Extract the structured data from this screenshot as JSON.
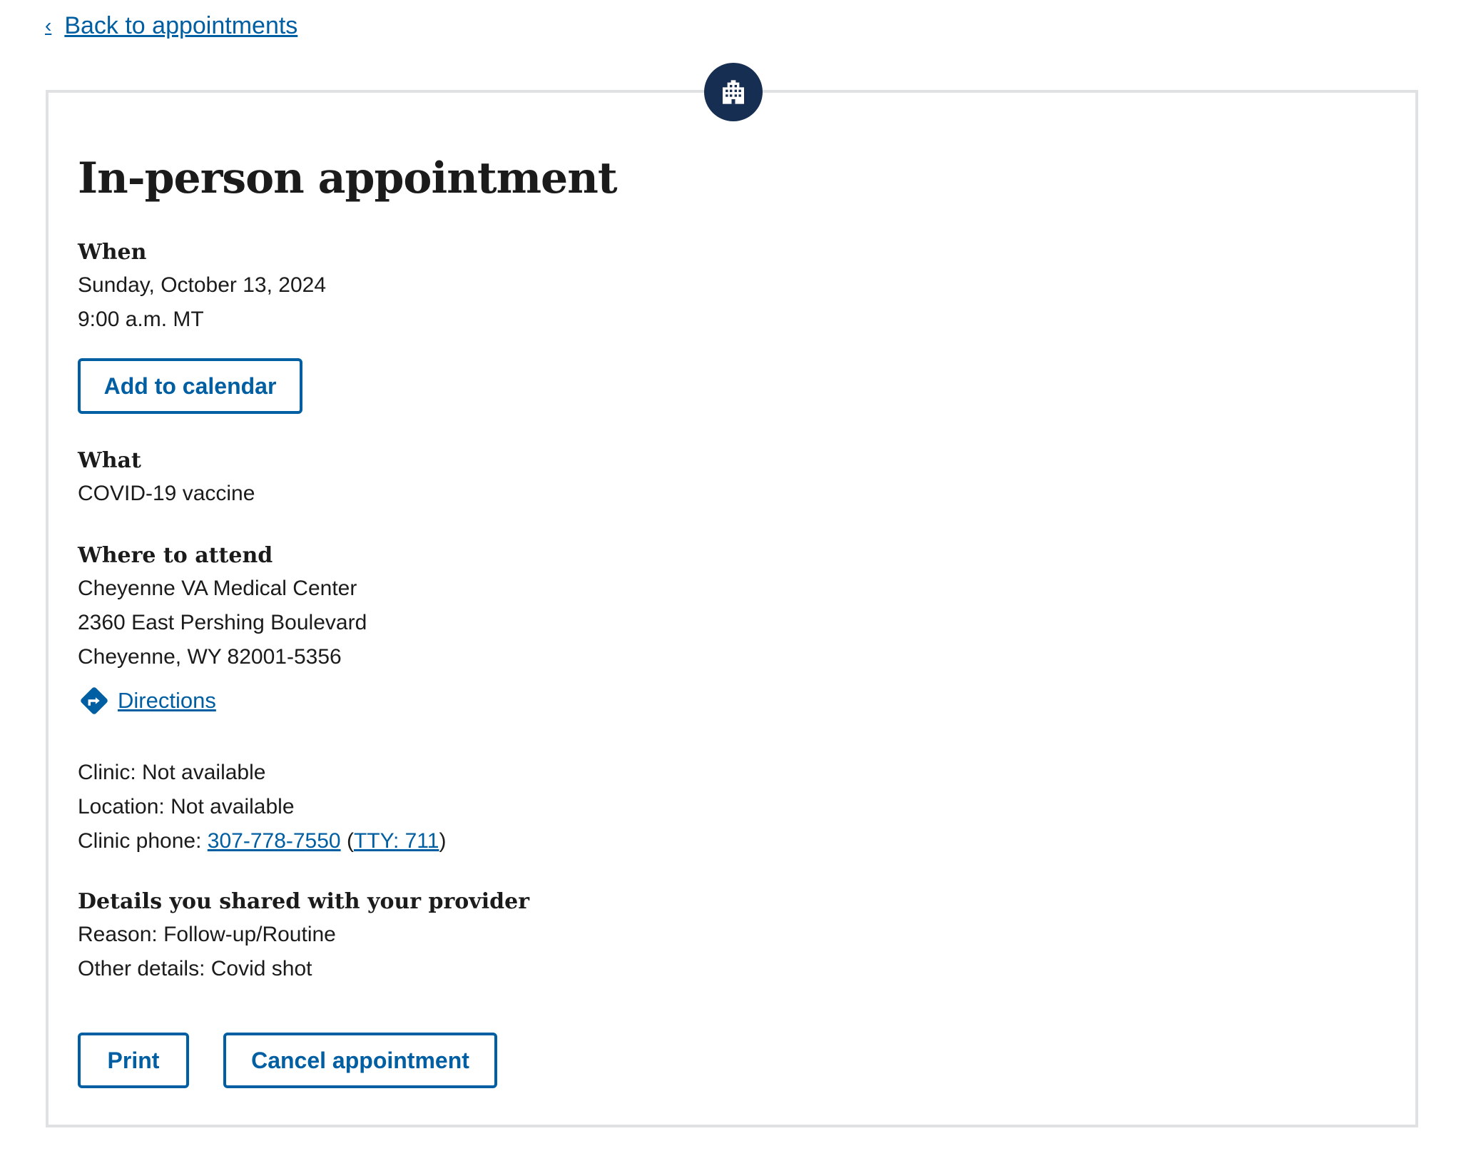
{
  "back_link": {
    "label": "Back to appointments",
    "chevron": "‹"
  },
  "header_icon": "hospital-building-icon",
  "title": "In-person appointment",
  "when": {
    "label": "When",
    "date": "Sunday, October 13, 2024",
    "time": "9:00 a.m. MT",
    "calendar_button": "Add to calendar"
  },
  "what": {
    "label": "What",
    "value": "COVID-19 vaccine"
  },
  "where": {
    "label": "Where to attend",
    "facility": "Cheyenne VA Medical Center",
    "street": "2360 East Pershing Boulevard",
    "city": "Cheyenne, WY 82001-5356",
    "directions_icon": "directions-icon",
    "directions_label": "Directions"
  },
  "clinic": {
    "clinic_line": "Clinic: Not available",
    "location_line": "Location: Not available",
    "phone_prefix": "Clinic phone: ",
    "phone": "307-778-7550",
    "tty_open": " (",
    "tty": "TTY: 711",
    "tty_close": ")"
  },
  "details": {
    "label": "Details you shared with your provider",
    "reason": "Reason: Follow-up/Routine",
    "other": "Other details: Covid shot"
  },
  "actions": {
    "print_label": "Print",
    "cancel_label": "Cancel appointment"
  },
  "colors": {
    "link": "#005ea2",
    "badge": "#162e51",
    "border": "#dfe1e2"
  }
}
